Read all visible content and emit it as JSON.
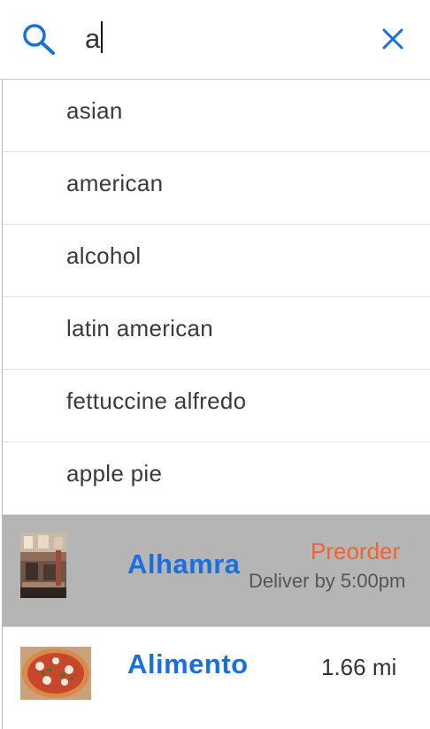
{
  "search": {
    "query": "a",
    "icon": "search-icon",
    "clear_icon": "close-icon"
  },
  "suggestions": [
    {
      "label": "asian"
    },
    {
      "label": "american"
    },
    {
      "label": "alcohol"
    },
    {
      "label": "latin american"
    },
    {
      "label": "fettuccine alfredo"
    },
    {
      "label": "apple pie"
    }
  ],
  "restaurants": [
    {
      "name": "Alhamra",
      "status": "Preorder",
      "delivery_note": "Deliver by 5:00pm",
      "thumbnail": "restaurant-interior-image"
    },
    {
      "name": "Alimento",
      "distance": "1.66 mi",
      "thumbnail": "pizza-image"
    }
  ],
  "colors": {
    "accent_blue": "#1a6fe0",
    "preorder_orange": "#f0642d",
    "highlight_gray": "#b5b5b5",
    "text": "#3a3a3a"
  }
}
